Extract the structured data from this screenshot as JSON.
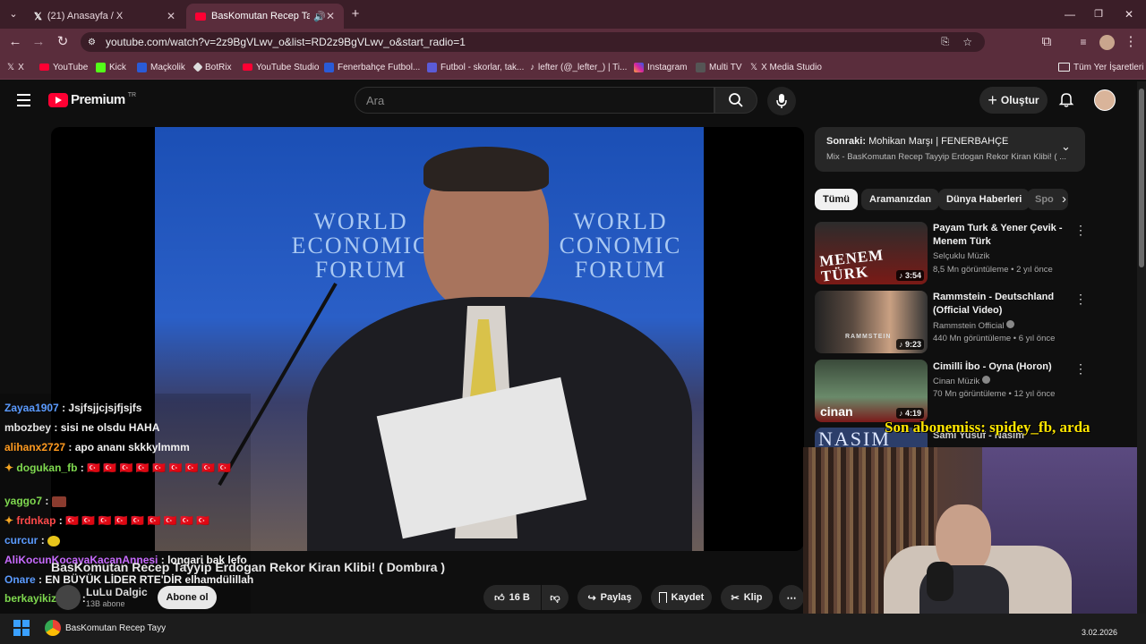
{
  "browser": {
    "tabs": [
      {
        "title": "(21) Anasayfa / X"
      },
      {
        "title": "BasKomutan Recep Tayyip"
      }
    ],
    "url": "youtube.com/watch?v=2z9BgVLwv_o&list=RD2z9BgVLwv_o&start_radio=1",
    "bookmarks": [
      "X",
      "YouTube",
      "Kick",
      "Maçkolik",
      "BotRix",
      "YouTube Studio",
      "Fenerbahçe Futbol...",
      "Futbol - skorlar, tak...",
      "lefter (@_lefter_) | Ti...",
      "Instagram",
      "Multi TV",
      "X Media Studio"
    ],
    "bookmarks_folder": "Tüm Yer İşaretleri"
  },
  "youtube": {
    "logo_text": "Premium",
    "logo_sup": "TR",
    "search_placeholder": "Ara",
    "create_label": "Oluştur"
  },
  "video": {
    "frame_text": [
      "WORLD",
      "ECONOMIC",
      "FORUM"
    ],
    "frame_text2": [
      "WORLD",
      "CONOMIC",
      "FORUM"
    ],
    "title": "BasKomutan Recep Tayyip Erdogan Rekor Kiran Klibi! ( Dombıra )",
    "channel": "LuLu Dalgic",
    "subs": "13B abone",
    "subscribe": "Abone ol",
    "likes": "16 B",
    "share": "Paylaş",
    "save": "Kaydet",
    "clip": "Klip"
  },
  "chat": [
    {
      "user": "Zayaa1907",
      "color": "#5b9bff",
      "msg": "Jsjfsjjcjsjfjsjfs"
    },
    {
      "user": "mbozbey",
      "color": "#e6e6e6",
      "msg": "sisi ne olsdu HAHA"
    },
    {
      "user": "alihanx2727",
      "color": "#ff9a1f",
      "msg": "apo ananı skkkylmmm"
    },
    {
      "user": "dogukan_fb",
      "color": "#7fd94f",
      "msg": "🇹🇷 🇹🇷 🇹🇷 🇹🇷 🇹🇷 🇹🇷 🇹🇷 🇹🇷 🇹🇷"
    },
    {
      "user": "yaggo7",
      "color": "#7fd94f",
      "msg": ""
    },
    {
      "user": "frdnkap",
      "color": "#ff4a4a",
      "msg": "🇹🇷 🇹🇷 🇹🇷 🇹🇷 🇹🇷 🇹🇷 🇹🇷 🇹🇷 🇹🇷"
    },
    {
      "user": "curcur",
      "color": "#5b9bff",
      "msg": ""
    },
    {
      "user": "AliKocunKocayaKacanAnnesi",
      "color": "#c86bff",
      "msg": "longari bak lefo"
    },
    {
      "user": "Onare",
      "color": "#5b9bff",
      "msg": "EN BÜYÜK LİDER RTE'DİR elhamdülillah"
    },
    {
      "user": "berkayikizoglu",
      "color": "#7fd94f",
      "msg": ""
    }
  ],
  "overlay": {
    "sub_text": "Son abonemiss: spidey_fb, arda"
  },
  "sidebar": {
    "next_label": "Sonraki:",
    "next_title": "Mohikan Marşı | FENERBAHÇE",
    "next_sub": "Mix - BasKomutan Recep Tayyip Erdogan Rekor Kiran Klibi! ( ...",
    "chips": [
      "Tümü",
      "Aramanızdan",
      "Dünya Haberleri",
      "Spo"
    ],
    "videos": [
      {
        "title": "Payam Turk & Yener Çevik - Menem Türk",
        "channel": "Selçuklu Müzik",
        "meta": "8,5 Mn görüntüleme • 2 yıl önce",
        "duration": "3:54",
        "thumb_text": "MENEM TÜRK"
      },
      {
        "title": "Rammstein - Deutschland (Official Video)",
        "channel": "Rammstein Official",
        "meta": "440 Mn görüntüleme • 6 yıl önce",
        "duration": "9:23",
        "thumb_text": "RAMMSTEIN"
      },
      {
        "title": "Cimilli İbo - Oyna (Horon)",
        "channel": "Cinan Müzik",
        "meta": "70 Mn görüntüleme • 12 yıl önce",
        "duration": "4:19",
        "thumb_text": "cinan"
      },
      {
        "title": "Sami Yusuf - Nasim",
        "channel": "",
        "meta": "",
        "duration": "",
        "thumb_text": "NASIM"
      }
    ]
  },
  "taskbar": {
    "app_label": "BasKomutan Recep Tayy",
    "date": "3.02.2026"
  }
}
